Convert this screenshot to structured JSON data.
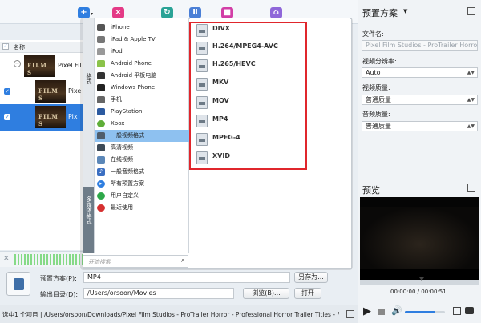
{
  "toolbar": {
    "buttons": [
      "add",
      "delete",
      "refresh",
      "pause",
      "stop",
      "merge"
    ]
  },
  "file_list": {
    "header_name": "名称",
    "rows": [
      {
        "name": "Pixel Fil",
        "thumb_text": "FILM S",
        "checked": false
      },
      {
        "name": "Pixe",
        "thumb_text": "FILM S",
        "checked": true
      },
      {
        "name": "Pix",
        "thumb_text": "FILM S",
        "checked": true
      }
    ]
  },
  "dropdown": {
    "vertical_tabs": [
      "格式",
      "多媒体格式"
    ],
    "categories": [
      {
        "label": "iPhone",
        "icon": "phone-icon"
      },
      {
        "label": "iPad & Apple TV",
        "icon": "tablet-icon"
      },
      {
        "label": "iPod",
        "icon": "ipod-icon"
      },
      {
        "label": "Android Phone",
        "icon": "android-icon"
      },
      {
        "label": "Android 平板电脑",
        "icon": "android-tablet-icon"
      },
      {
        "label": "Windows Phone",
        "icon": "windows-icon"
      },
      {
        "label": "手机",
        "icon": "mobile-icon"
      },
      {
        "label": "PlayStation",
        "icon": "playstation-icon"
      },
      {
        "label": "Xbox",
        "icon": "xbox-icon"
      },
      {
        "label": "一般视频格式",
        "icon": "video-format-icon",
        "selected": true
      },
      {
        "label": "高清视频",
        "icon": "hd-video-icon"
      },
      {
        "label": "在线视频",
        "icon": "online-video-icon"
      },
      {
        "label": "一般音频格式",
        "icon": "audio-icon"
      },
      {
        "label": "所有预置方案",
        "icon": "presets-icon"
      },
      {
        "label": "用户自定义",
        "icon": "user-custom-icon"
      },
      {
        "label": "最近使用",
        "icon": "recent-icon"
      }
    ],
    "formats": [
      "DIVX",
      "H.264/MPEG4-AVC",
      "H.265/HEVC",
      "MKV",
      "MOV",
      "MP4",
      "MPEG-4",
      "XVID"
    ],
    "search_placeholder": "开始搜索"
  },
  "output": {
    "preset_label": "预置方案(P):",
    "preset_value": "MP4",
    "save_as": "另存为...",
    "dir_label": "输出目录(D):",
    "dir_value": "/Users/orsoon/Movies",
    "browse": "浏览(B)...",
    "open": "打开"
  },
  "status": {
    "text": "选中1 个项目 | /Users/orsoon/Downloads/Pixel Film Studios - ProTrailer Horror - Professional Horror Trailer Titles - Final"
  },
  "right_panel": {
    "title": "预置方案",
    "filename_label": "文件名:",
    "filename_value": "Pixel Film Studios - ProTrailer Horror",
    "resolution_label": "视频分辨率:",
    "resolution_value": "Auto",
    "video_quality_label": "视频质量:",
    "video_quality_value": "普通质量",
    "audio_quality_label": "音频质量:",
    "audio_quality_value": "普通质量",
    "preview_title": "预览",
    "time": "00:00:00 / 00:00:51",
    "volume": 0.75
  },
  "colors": {
    "accent": "#2f7ee0",
    "selected": "#8ec1f0",
    "highlight_box": "#e0262c"
  }
}
